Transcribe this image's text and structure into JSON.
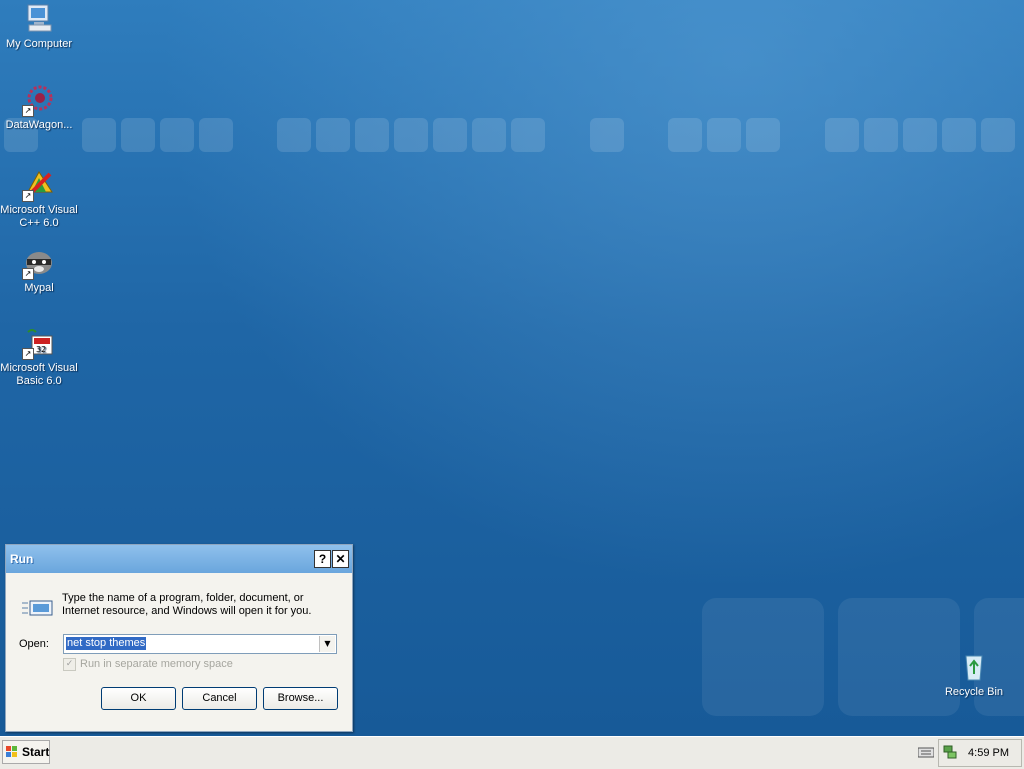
{
  "desktop": {
    "icons": [
      {
        "label": "My Computer"
      },
      {
        "label": "DataWagon..."
      },
      {
        "label": "Microsoft Visual C++ 6.0"
      },
      {
        "label": "Mypal"
      },
      {
        "label": "Microsoft Visual Basic 6.0"
      },
      {
        "label": "Recycle Bin"
      }
    ]
  },
  "run_dialog": {
    "title": "Run",
    "help_label": "?",
    "close_label": "✕",
    "description": "Type the name of a program, folder, document, or Internet resource, and Windows will open it for you.",
    "open_label": "Open:",
    "open_value": "net stop themes",
    "separate_memory_label": "Run in separate memory space",
    "separate_memory_checked": true,
    "ok_label": "OK",
    "cancel_label": "Cancel",
    "browse_label": "Browse..."
  },
  "taskbar": {
    "start_label": "Start",
    "clock": "4:59 PM"
  },
  "colors": {
    "desktop": "#1f66a6",
    "title_bar": "#7ab3e6",
    "selection": "#316ac5"
  }
}
